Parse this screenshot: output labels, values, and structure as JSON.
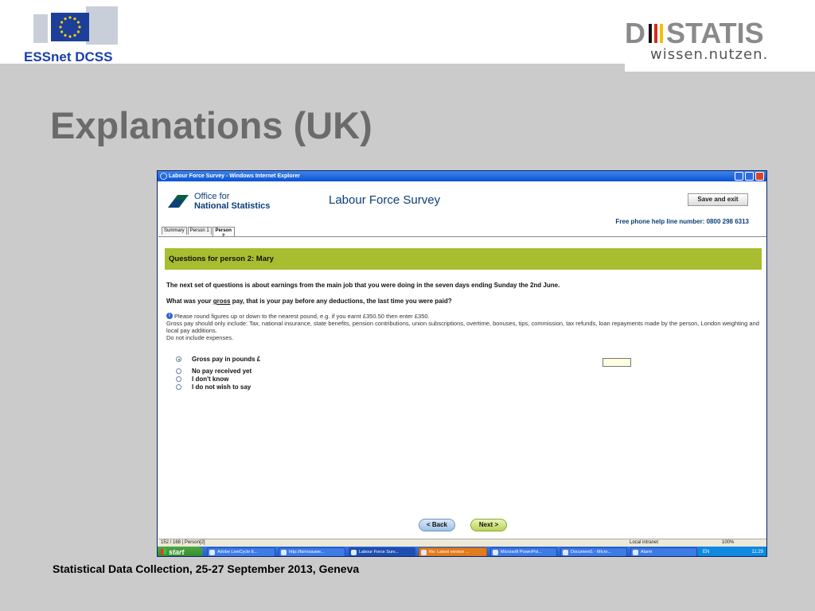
{
  "slide": {
    "brand_left": "ESSnet DCSS",
    "brand_right_word": "DESTATIS",
    "brand_right_tagline": "wissen.nutzen.",
    "title": "Explanations (UK)",
    "footer": "Statistical Data Collection, 25-27 September 2013, Geneva"
  },
  "window": {
    "title": "Labour Force Survey - Windows Internet Explorer"
  },
  "survey": {
    "org_line1": "Office for",
    "org_line2": "National Statistics",
    "title": "Labour Force Survey",
    "save_exit": "Save and exit",
    "helpline": "Free phone help line number: 0800 298 6313",
    "tabs": [
      "Summary",
      "Person 1",
      "Person 2"
    ],
    "section_heading": "Questions for person 2: Mary",
    "intro": "The next set of questions is about earnings from the main job that you were doing in the seven days ending Sunday the 2nd June.",
    "question_pre": "What was your ",
    "question_em": "gross",
    "question_post": " pay, that is your pay before any deductions, the last time you were paid?",
    "info_line1": "Please round figures up or down to the nearest pound, e.g. if you earnt £350.50 then enter £350.",
    "info_line2": "Gross pay should only include: Tax, national insurance, state benefits, pension contributions, union subscriptions, overtime, bonuses, tips, commission, tax refunds, loan repayments made by the person, London weighting and local pay additions.",
    "info_line3": "Do not include expenses.",
    "options": [
      {
        "label": "Gross pay in pounds £",
        "checked": true
      },
      {
        "label": "No pay received yet",
        "checked": false
      },
      {
        "label": "I don't know",
        "checked": false
      },
      {
        "label": "I do not wish to say",
        "checked": false
      }
    ],
    "pay_value": "",
    "back": "< Back",
    "next": "Next >"
  },
  "statusbar": {
    "left": "152 / 168 | Person[2]",
    "zone": "Local intranet",
    "zoom": "100%"
  },
  "taskbar": {
    "start": "start",
    "tasks": [
      "Adobe LiveCycle E...",
      "http://fairvsauwe...",
      "Labour Force Surv...",
      "Re: Latest version ...",
      "Microsoft PowerPoi...",
      "Document1 - Micro...",
      "Alarm"
    ],
    "lang": "EN",
    "clock": "11:29"
  }
}
